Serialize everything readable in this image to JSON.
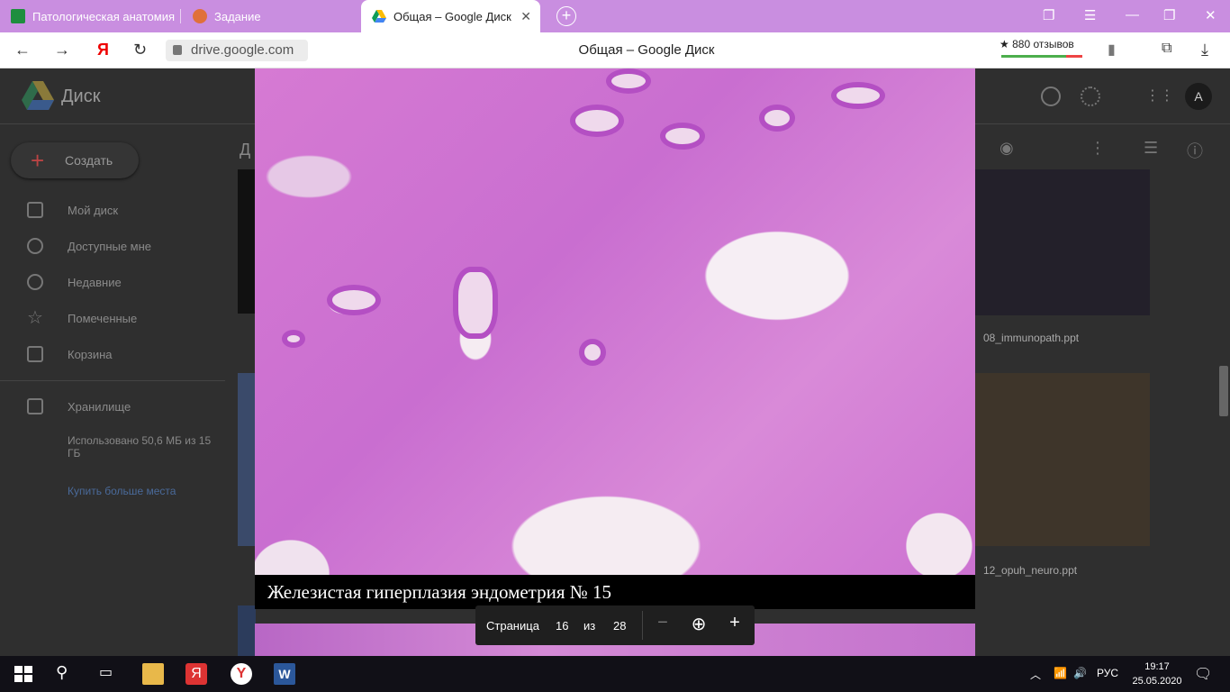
{
  "browser": {
    "tabs": [
      {
        "label": "Патологическая анатомия"
      },
      {
        "label": "Задание"
      },
      {
        "label": "Общая – Google Диск"
      }
    ],
    "url": "drive.google.com",
    "page_title": "Общая – Google Диск",
    "reviews": "★ 880 отзывов"
  },
  "drive": {
    "app_name": "Диск",
    "create_label": "Создать",
    "sidebar": [
      {
        "label": "Мой диск"
      },
      {
        "label": "Доступные мне"
      },
      {
        "label": "Недавние"
      },
      {
        "label": "Помеченные"
      },
      {
        "label": "Корзина"
      }
    ],
    "storage_label": "Хранилище",
    "storage_used": "Использовано 50,6 МБ из 15 ГБ",
    "buy_more": "Купить больше места",
    "breadcrumb_fragment": "Д",
    "files": [
      {
        "name": "08_immunopath.ppt"
      },
      {
        "name": "12_opuh_neuro.ppt"
      }
    ],
    "avatar_letter": "A"
  },
  "viewer": {
    "caption": "Железистая гиперплазия эндометрия № 15",
    "page_label": "Страница",
    "page_current": "16",
    "page_of": "из",
    "page_total": "28"
  },
  "taskbar": {
    "language": "РУС",
    "time": "19:17",
    "date": "25.05.2020"
  }
}
